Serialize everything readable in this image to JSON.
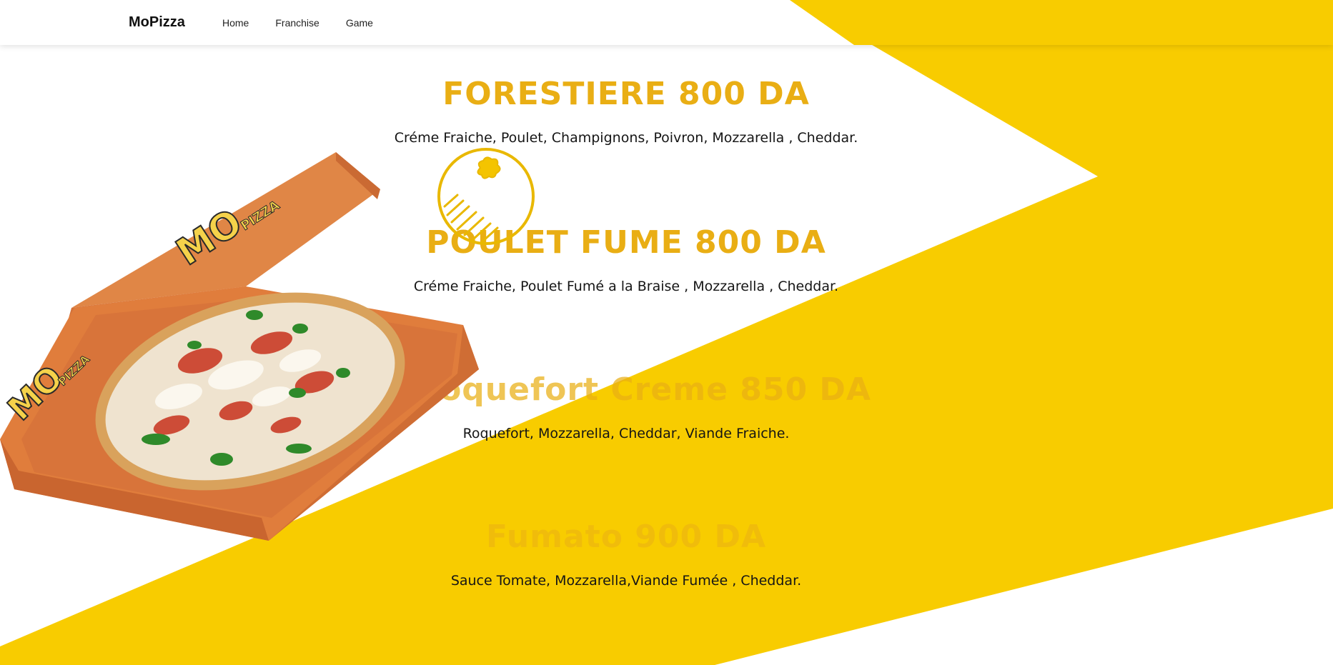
{
  "nav": {
    "brand": "MoPizza",
    "links": [
      {
        "label": "Home"
      },
      {
        "label": "Franchise"
      },
      {
        "label": "Game"
      }
    ]
  },
  "menu": {
    "items": [
      {
        "title": "FORESTIERE 800 DA",
        "description": "Créme Fraiche, Poulet, Champignons, Poivron, Mozzarella , Cheddar."
      },
      {
        "title": "POULET FUME 800 DA",
        "description": "Créme Fraiche, Poulet Fumé a la Braise , Mozzarella , Cheddar."
      },
      {
        "title": "e Roquefort Creme 850 DA",
        "description": "Roquefort, Mozzarella, Cheddar, Viande Fraiche."
      },
      {
        "title": "Fumato 900 DA",
        "description": "Sauce Tomate, Mozzarella,Viande Fumée , Cheddar."
      }
    ]
  },
  "box_branding": {
    "logo_text": "MO",
    "sub_text": "PIZZA"
  },
  "colors": {
    "accent_yellow": "#f8cc00",
    "title_gold": "#e9ae14",
    "box_orange": "#e07d3c",
    "text_dark": "#151515"
  },
  "icons": {
    "doodle": "pizza-doodle-icon"
  }
}
